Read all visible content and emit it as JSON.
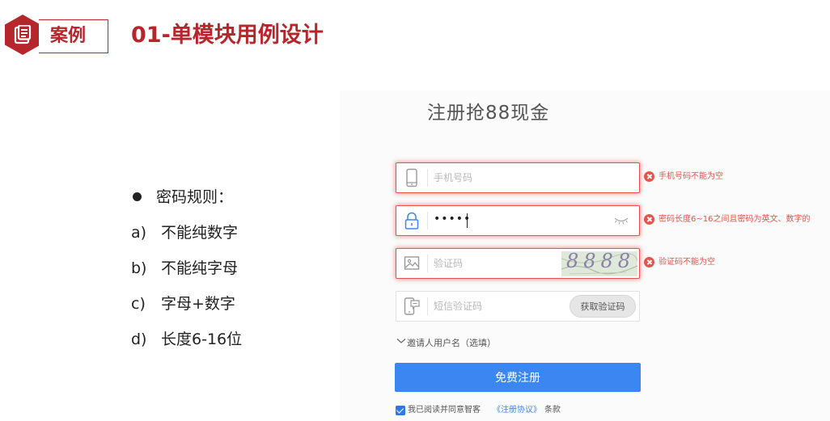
{
  "header": {
    "case_label": "案例",
    "title": "01-单模块用例设计",
    "accent_color": "#b5272b",
    "badge_icon": "document-icon"
  },
  "rules": {
    "title": "密码规则：",
    "items": [
      {
        "letter": "a)",
        "text": "不能纯数字"
      },
      {
        "letter": "b)",
        "text": "不能纯字母"
      },
      {
        "letter": "c)",
        "text": "字母+数字"
      },
      {
        "letter": "d)",
        "text": "长度6-16位"
      }
    ]
  },
  "form": {
    "title": "注册抢88现金",
    "phone": {
      "placeholder": "手机号码",
      "value": "",
      "icon": "phone-icon",
      "error": "手机号码不能为空"
    },
    "password": {
      "value_masked": "•••••",
      "icon": "lock-icon",
      "toggle_icon": "eye-closed-icon",
      "error": "密码长度6~16之间且密码为英文、数字的"
    },
    "captcha": {
      "placeholder": "验证码",
      "value": "",
      "icon": "image-icon",
      "captcha_text": "8888",
      "error": "验证码不能为空"
    },
    "sms": {
      "placeholder": "短信验证码",
      "value": "",
      "icon": "sms-phone-icon",
      "button_label": "获取验证码"
    },
    "inviter_label": "邀请人用户名（选填）",
    "submit_label": "免费注册",
    "agree": {
      "checked": true,
      "prefix": "我已阅读并同意智客",
      "link": "《注册协议》",
      "suffix": "条款"
    },
    "error_color": "#e5534b",
    "primary_color": "#3b86f0"
  }
}
